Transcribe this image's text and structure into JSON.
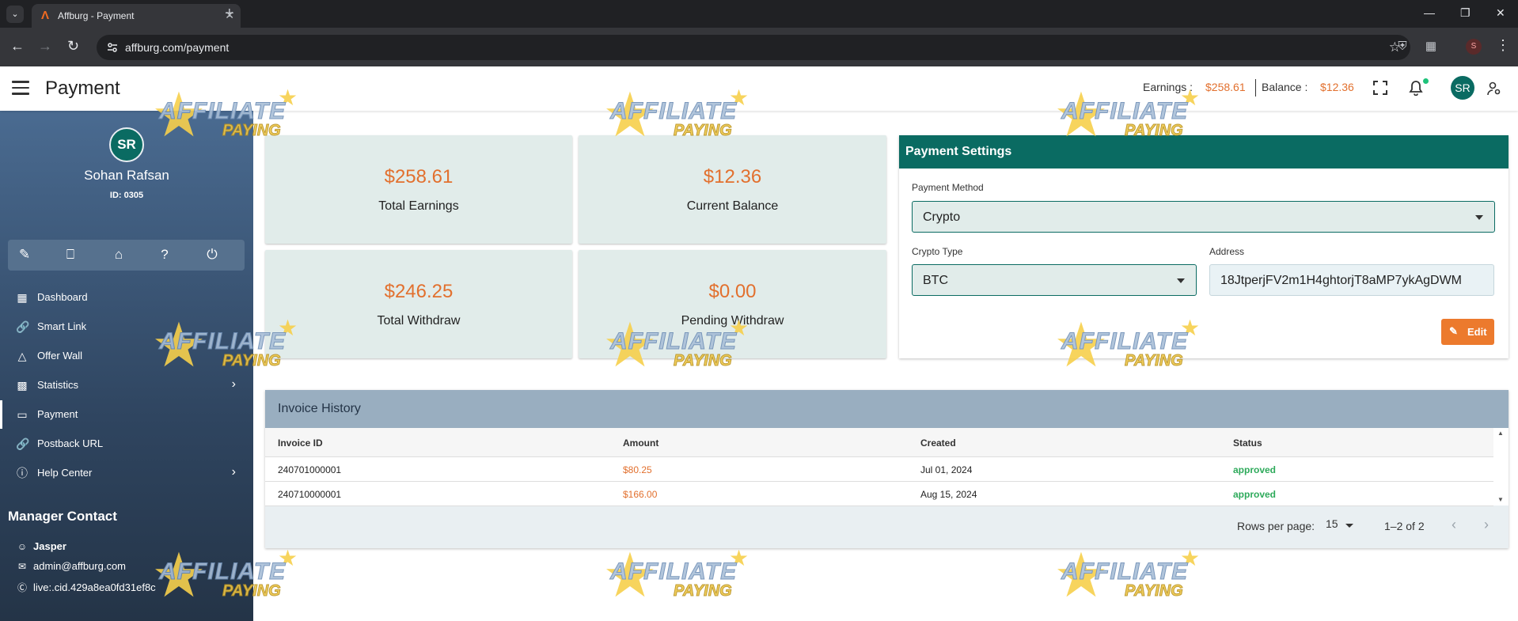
{
  "browser": {
    "tab_title": "Affburg - Payment",
    "url": "affburg.com/payment",
    "profile_initial": "S"
  },
  "header": {
    "page_title": "Payment",
    "earnings_label": "Earnings :",
    "earnings_value": "$258.61",
    "balance_label": "Balance :",
    "balance_value": "$12.36",
    "avatar_initials": "SR"
  },
  "sidebar": {
    "avatar_initials": "SR",
    "user_name": "Sohan Rafsan",
    "user_id": "ID: 0305",
    "menu": [
      {
        "label": "Dashboard",
        "icon": "dashboard-icon"
      },
      {
        "label": "Smart Link",
        "icon": "link-icon"
      },
      {
        "label": "Offer Wall",
        "icon": "offerwall-icon"
      },
      {
        "label": "Statistics",
        "icon": "chart-icon"
      },
      {
        "label": "Payment",
        "icon": "card-icon"
      },
      {
        "label": "Postback URL",
        "icon": "link-icon"
      },
      {
        "label": "Help Center",
        "icon": "help-circle-icon"
      }
    ],
    "manager_title": "Manager Contact",
    "manager_name": "Jasper",
    "manager_email": "admin@affburg.com",
    "manager_skype": "live:.cid.429a8ea0fd31ef8c"
  },
  "stats": {
    "total_earnings": {
      "value": "$258.61",
      "label": "Total Earnings"
    },
    "current_balance": {
      "value": "$12.36",
      "label": "Current Balance"
    },
    "total_withdraw": {
      "value": "$246.25",
      "label": "Total Withdraw"
    },
    "pending_withdraw": {
      "value": "$0.00",
      "label": "Pending Withdraw"
    }
  },
  "payment_settings": {
    "title": "Payment Settings",
    "method_label": "Payment Method",
    "method_value": "Crypto",
    "crypto_type_label": "Crypto Type",
    "crypto_type_value": "BTC",
    "address_label": "Address",
    "address_value": "18JtperjFV2m1H4ghtorjT8aMP7ykAgDWM",
    "edit_label": "Edit"
  },
  "invoice_history": {
    "title": "Invoice History",
    "columns": [
      "Invoice ID",
      "Amount",
      "Created",
      "Status"
    ],
    "rows": [
      {
        "id": "240701000001",
        "amount": "$80.25",
        "created": "Jul 01, 2024",
        "status": "approved"
      },
      {
        "id": "240710000001",
        "amount": "$166.00",
        "created": "Aug 15, 2024",
        "status": "approved"
      }
    ],
    "rows_per_page_label": "Rows per page:",
    "rows_per_page_value": "15",
    "range": "1–2 of 2"
  },
  "watermark": {
    "line1": "AFFILIATE",
    "line2": "PAYING"
  },
  "colors": {
    "accent_orange": "#e2702e",
    "teal": "#0a6b62",
    "status_green": "#2eaa5b"
  }
}
